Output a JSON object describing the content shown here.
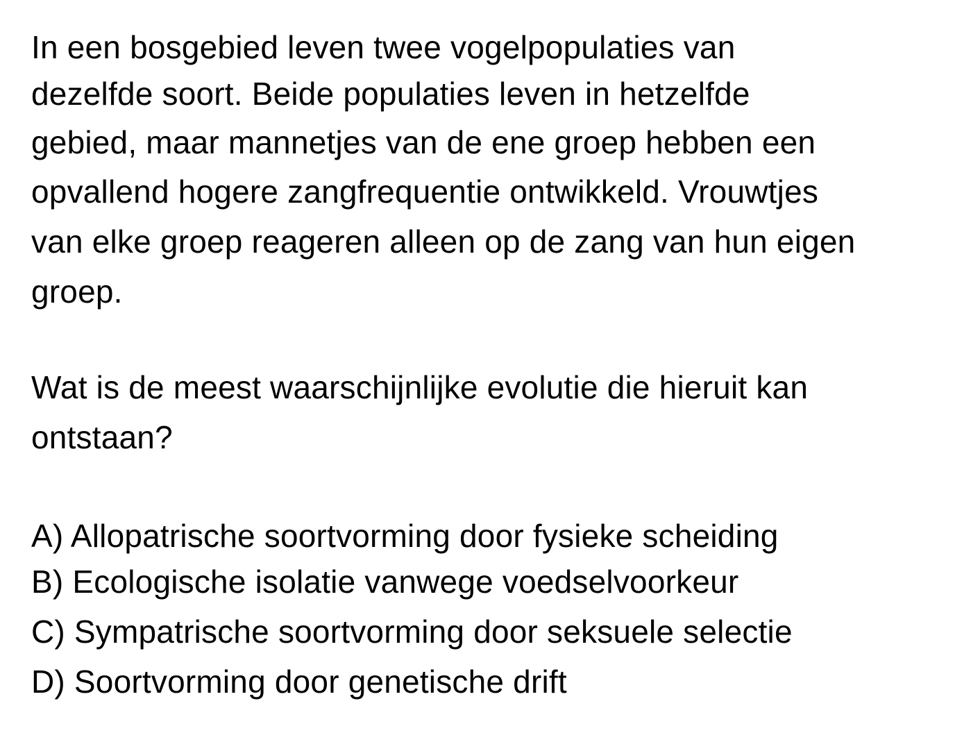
{
  "question": {
    "stem_lines": [
      "In een bosgebied leven twee vogelpopulaties van",
      "dezelfde soort. Beide populaties leven in hetzelfde",
      "gebied, maar mannetjes van de ene groep hebben een",
      "opvallend hogere zangfrequentie ontwikkeld. Vrouwtjes",
      "van elke groep reageren alleen op de zang van hun eigen",
      "groep."
    ],
    "prompt_lines": [
      "Wat is de meest waarschijnlijke evolutie die hieruit kan",
      "ontstaan?"
    ],
    "options": [
      "A) Allopatrische soortvorming door fysieke scheiding",
      "B) Ecologische isolatie vanwege voedselvoorkeur",
      "C) Sympatrische soortvorming door seksuele selectie",
      "D) Soortvorming door genetische drift"
    ]
  }
}
